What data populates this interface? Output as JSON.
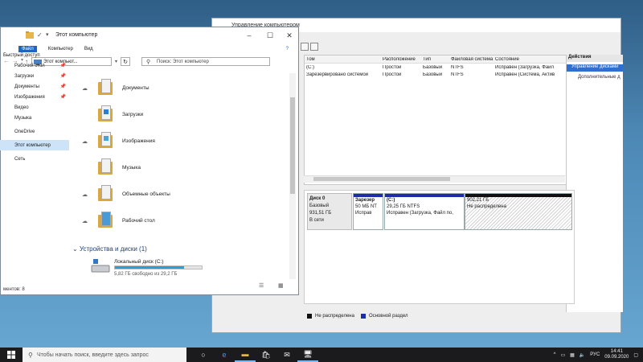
{
  "computer_management": {
    "title": "Управление компьютером",
    "volume_table": {
      "columns": [
        "Том",
        "Расположение",
        "Тип",
        "Файловая система",
        "Состояние"
      ],
      "rows": [
        [
          "(C:)",
          "Простой",
          "Базовый",
          "NTFS",
          "Исправен (Загрузка, Файл"
        ],
        [
          "Зарезервировано системой",
          "Простой",
          "Базовый",
          "NTFS",
          "Исправен (Система, Актив"
        ]
      ]
    },
    "actions": {
      "header": "Действия",
      "selected": "Управление дисками",
      "more": "Дополнительные д"
    },
    "disk": {
      "name": "Диск 0",
      "type": "Базовый",
      "size": "931,51 ГБ",
      "status": "В сети",
      "partitions": [
        {
          "name": "Зарезер",
          "size": "50 МБ NT",
          "state": "Исправ"
        },
        {
          "name": "(C:)",
          "size": "29,25 ГБ NTFS",
          "state": "Исправен (Загрузка, Файл по,"
        },
        {
          "name": "",
          "size": "902,21 ГБ",
          "state": "Не распределена"
        }
      ]
    },
    "legend": [
      {
        "label": "Не распределена",
        "color": "#111111"
      },
      {
        "label": "Основной раздел",
        "color": "#1b2ea8"
      }
    ]
  },
  "explorer": {
    "title": "Этот компьютер",
    "ribbon": {
      "file": "Файл",
      "computer": "Компьютер",
      "view": "Вид"
    },
    "address": "Этот компьют...",
    "search_placeholder": "Поиск: Этот компьютер",
    "nav": [
      {
        "label": "Быстрый доступ",
        "pinned": false
      },
      {
        "label": "Рабочий стол",
        "pinned": true
      },
      {
        "label": "Загрузки",
        "pinned": true
      },
      {
        "label": "Документы",
        "pinned": true
      },
      {
        "label": "Изображения",
        "pinned": true
      },
      {
        "label": "Видео",
        "pinned": false
      },
      {
        "label": "Музыка",
        "pinned": false
      },
      {
        "label": "OneDrive",
        "pinned": false
      },
      {
        "label": "Этот компьютер",
        "pinned": false
      },
      {
        "label": "Сеть",
        "pinned": false
      }
    ],
    "folders": [
      "Документы",
      "Загрузки",
      "Изображения",
      "Музыка",
      "Объемные объекты",
      "Рабочий стол"
    ],
    "devices_header": "Устройства и диски (1)",
    "drive": {
      "name": "Локальный диск (C:)",
      "free": "5,82 ГБ свободно из 29,2 ГБ",
      "used_fraction": 0.8
    },
    "status": "ментов: 8"
  },
  "taskbar": {
    "search_placeholder": "Чтобы начать поиск, введите здесь запрос",
    "lang": "РУС",
    "time": "14:41",
    "date": "09.09.2020"
  },
  "icons": [
    "windows-start-icon",
    "search-icon",
    "task-view-icon",
    "edge-icon",
    "file-explorer-icon",
    "store-icon",
    "mail-icon",
    "computer-management-icon"
  ]
}
